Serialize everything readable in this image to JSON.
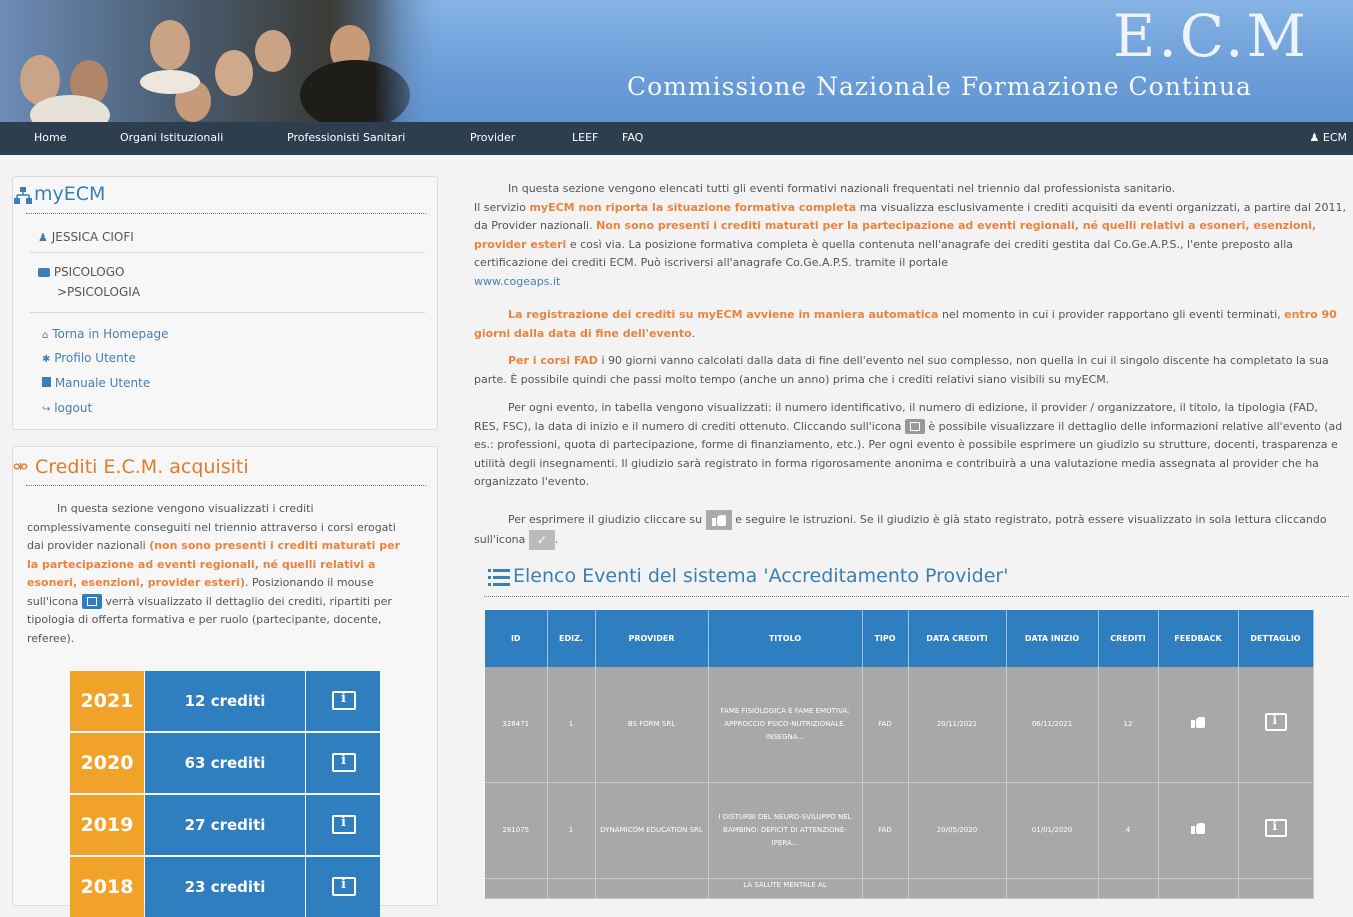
{
  "header": {
    "title": "E.C.M",
    "subtitle": "Commissione Nazionale Formazione Continua"
  },
  "nav": {
    "items": [
      "Home",
      "Organi Istituzionali",
      "Professionisti Sanitari",
      "Provider",
      "LEEF",
      "FAQ"
    ],
    "user": "ECM"
  },
  "sidebar": {
    "title": "myECM",
    "user_name": "JESSICA CIOFI",
    "profession": "PSICOLOGO",
    "discipline": ">PSICOLOGIA",
    "links": [
      "Torna in Homepage",
      "Profilo Utente",
      "Manuale Utente",
      "logout"
    ]
  },
  "crediti": {
    "title": "Crediti E.C.M. acquisiti",
    "desc_1": "In questa sezione vengono visualizzati i crediti complessivamente conseguiti nel triennio attraverso i corsi erogati dai provider nazionali",
    "desc_2": "(non sono presenti i crediti maturati per la partecipazione ad eventi regionali, né quelli relativi a esoneri, esenzioni, provider esteri)",
    "desc_3": ". Posizionando il mouse sull'icona",
    "desc_4": "verrà visualizzato il dettaglio dei crediti, ripartiti per tipologia di offerta formativa e per ruolo (partecipante, docente, referee).",
    "years": [
      {
        "year": "2021",
        "credits": "12 crediti"
      },
      {
        "year": "2020",
        "credits": "63 crediti"
      },
      {
        "year": "2019",
        "credits": "27 crediti"
      },
      {
        "year": "2018",
        "credits": "23 crediti"
      }
    ]
  },
  "main": {
    "p1a": "In questa sezione vengono elencati tutti gli eventi formativi nazionali frequentati nel triennio dal professionista sanitario.",
    "p1b": "Il servizio",
    "p1c": "myECM non riporta la situazione formativa completa",
    "p1d": "ma visualizza esclusivamente i crediti acquisiti da eventi organizzati, a partire dal 2011, da Provider nazionali.",
    "p1e": "Non sono presenti i crediti maturati per la partecipazione ad eventi regionali, né quelli relativi a esoneri, esenzioni, provider esteri",
    "p1f": "e così via. La posizione formativa completa è quella contenuta nell'anagrafe dei crediti gestita dal Co.Ge.A.P.S., l'ente preposto alla certificazione dei crediti ECM. Può iscriversi all'anagrafe Co.Ge.A.P.S. tramite il portale",
    "p1g": "www.cogeaps.it",
    "p2a": "La registrazione dei crediti su myECM avviene in maniera automatica",
    "p2b": "nel momento in cui i provider rapportano gli eventi terminati,",
    "p2c": "entro 90 giorni dalla data di fine dell'evento",
    "p3a": "Per i corsi FAD",
    "p3b": "i 90 giorni vanno calcolati dalla data di fine dell'evento nel suo complesso, non quella in cui il singolo discente ha completato la sua parte. È possibile quindi che passi molto tempo (anche un anno) prima che i crediti relativi siano visibili su myECM.",
    "p4a": "Per ogni evento, in tabella vengono visualizzati: il numero identificativo, il numero di edizione, il provider / organizzatore, il titolo, la tipologia (FAD, RES, FSC), la data di inizio e il numero di crediti ottenuto. Cliccando sull'icona",
    "p4b": "è possibile visualizzare il dettaglio delle informazioni relative all'evento (ad es.: professioni, quota di partecipazione, forme di finanziamento, etc.). Per ogni evento è possibile esprimere un giudizio su strutture, docenti, trasparenza e utilità degli insegnamenti. Il giudizio sarà registrato in forma rigorosamente anonima e contribuirà a una valutazione media assegnata al provider che ha organizzato l'evento.",
    "p5a": "Per esprimere il giudizio cliccare su",
    "p5b": "e seguire le istruzioni. Se il giudizio è già stato registrato, potrà essere visualizzato in sola lettura cliccando sull'icona",
    "elenco_title": "Elenco Eventi del sistema 'Accreditamento Provider'"
  },
  "table": {
    "headers": [
      "ID",
      "EDIZ.",
      "PROVIDER",
      "TITOLO",
      "TIPO",
      "DATA CREDITI",
      "DATA INIZIO",
      "CREDITI",
      "FEEDBACK",
      "DETTAGLIO"
    ],
    "rows": [
      [
        "328471",
        "1",
        "BS FORM SRL",
        "FAME FISIOLOGICA E FAME EMOTIVA: APPROCCIO PSICO-NUTRIZIONALE. INSEGNA...",
        "FAD",
        "20/11/2021",
        "06/11/2021",
        "12"
      ],
      [
        "281075",
        "1",
        "DYNAMICOM EDUCATION SRL",
        "I DISTURBI DEL NEURO-SVILUPPO NEL BAMBINO: DEFICIT DI ATTENZIONE-IPERA...",
        "FAD",
        "20/05/2020",
        "01/01/2020",
        "4"
      ],
      [
        "",
        "",
        "",
        "LA SALUTE MENTALE AL",
        "",
        "",
        "",
        ""
      ]
    ]
  },
  "colors": {
    "header_bg": "#6d9fd9",
    "nav_bg": "#2d3e4e",
    "accent_blue": "#2e7ec0",
    "accent_orange": "#f0a328",
    "link_blue": "#4a7fae",
    "highlight_orange": "#e8843e"
  }
}
